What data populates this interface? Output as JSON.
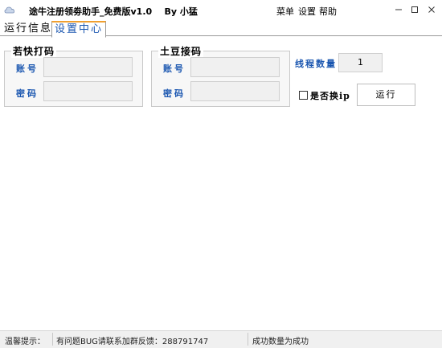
{
  "window": {
    "title": "途牛注册领劵助手_免费版v1.0",
    "author": "By 小猛",
    "menus": [
      "菜单",
      "设置",
      "帮助"
    ],
    "icon": "app-cloud-icon"
  },
  "tabs": [
    {
      "label": "运行信息",
      "active": false
    },
    {
      "label": "设置中心",
      "active": true
    }
  ],
  "groups": {
    "captcha1": {
      "title": "若快打码",
      "account_label": "账号",
      "password_label": "密码",
      "account_value": "",
      "password_value": ""
    },
    "captcha2": {
      "title": "土豆接码",
      "account_label": "账号",
      "password_label": "密码",
      "account_value": "",
      "password_value": ""
    }
  },
  "thread": {
    "label": "线程数量",
    "value": "1"
  },
  "switch_ip": {
    "label": "是否换ip",
    "checked": false
  },
  "run_button": "运行",
  "status": {
    "tip_label": "温馨提示：",
    "message": "有问题BUG请联系加群反馈：288791747",
    "success_count": "成功数量为成功"
  },
  "colors": {
    "label_blue": "#1a56b0",
    "tab_accent": "#f0a030"
  }
}
